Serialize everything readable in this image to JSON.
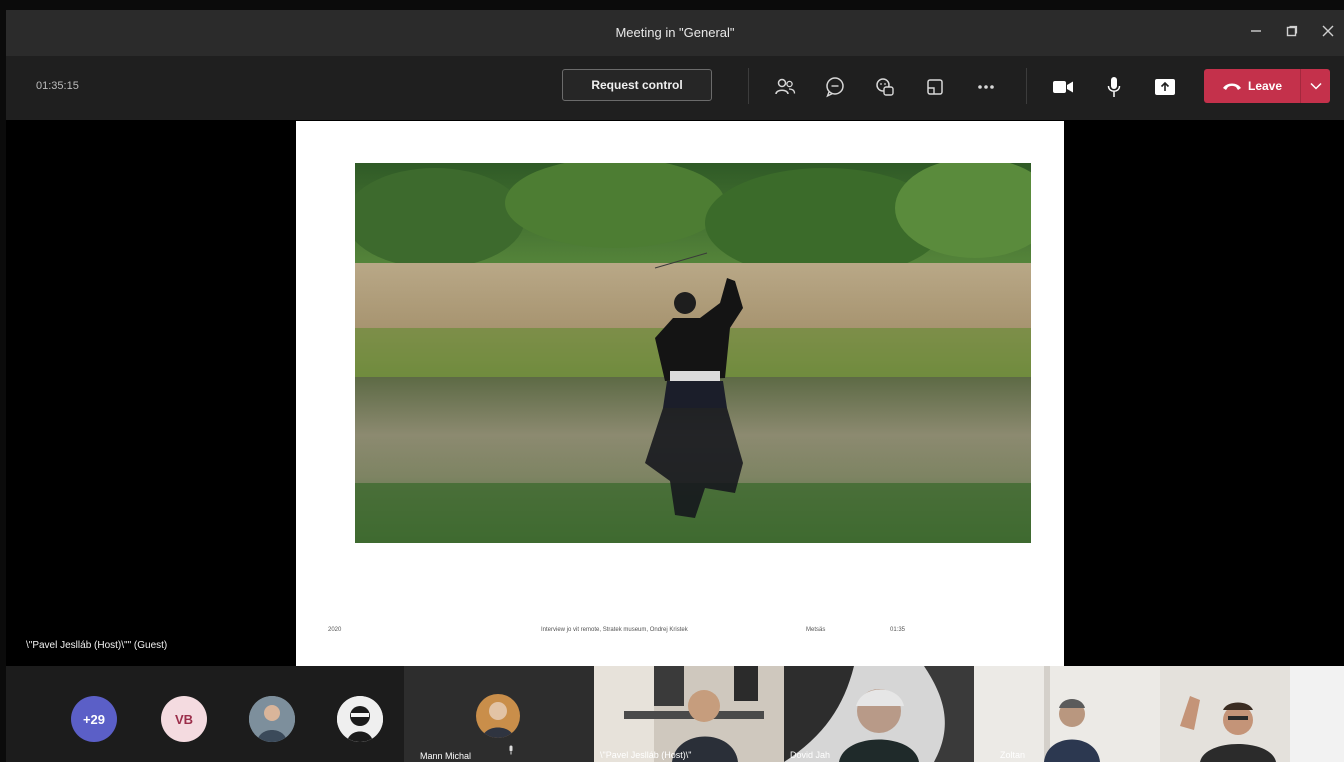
{
  "window": {
    "title": "Meeting in \"General\"",
    "controls": [
      "minimize-icon",
      "restore-icon",
      "close-icon"
    ]
  },
  "toolbar": {
    "timer": "01:35:15",
    "request_control_label": "Request control",
    "icons": [
      "people-icon",
      "chat-icon",
      "reactions-icon",
      "rooms-icon",
      "more-icon",
      "camera-icon",
      "microphone-icon",
      "share-icon"
    ],
    "leave_label": "Leave"
  },
  "slide": {
    "footer": [
      "2020",
      "Interview jo vit remote, Stratek museum, Ondrej Kristek",
      "Metsäs",
      "01:35"
    ]
  },
  "stage": {
    "presenter_label": "\\\"Pavel Jeslláb (Host)\\\"\" (Guest)"
  },
  "gallery": {
    "overflow_count": "+29",
    "initials": "VB",
    "active_name": "Mann Michal",
    "tile_names": [
      "\\\"Pavel Jeslláb (Host)\\\"",
      "Dovid Jah",
      "Zoltan",
      ""
    ]
  },
  "colors": {
    "leave": "#c4314b",
    "overflow_badge": "#5b5fc7",
    "initials_badge": "#f4dbe0",
    "toolbar": "#1f1f1f",
    "titlebar": "#2b2b2b"
  }
}
